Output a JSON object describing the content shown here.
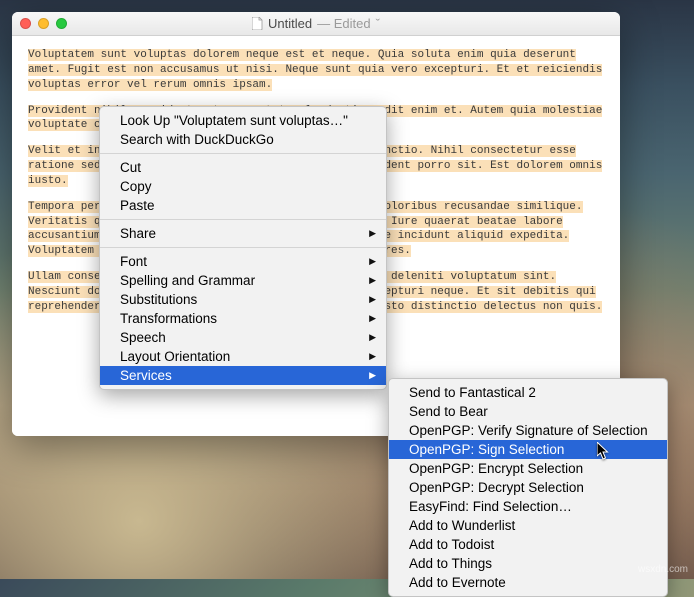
{
  "window": {
    "title": "Untitled",
    "subtitle": "— Edited",
    "status_suffix": "ˇ"
  },
  "editor": {
    "paragraphs": [
      "Voluptatem sunt voluptas dolorem neque est et neque. Quia soluta enim quia deserunt amet. Fugit est non accusamus ut nisi. Neque sunt quia vero excepturi. Et et reiciendis voluptas error vel rerum omnis ipsam.",
      "Provident nihil provident aut consectetur laudantium odit enim et. Autem quia molestiae voluptate consequuntur ut deleniti eat.",
      "Velit et in voluptas sit perspiciatis quas error distinctio. Nihil consectetur esse ratione sed aliquid quidem voluptates a. Tempora provident porro sit. Est dolorem omnis iusto.",
      "Tempora perferendis nesciunt. Alias rerum eos facere doloribus recusandae similique. Veritatis qui voluptatem. Sed dolores culpa molestias. Iure quaerat beatae labore accusantium aut totam. Omnis natus ipsum eaque rem iure incidunt aliquid expedita. Voluptatem eius consequatur sit aut laboriosam asperiores.",
      "Ullam consequatur ut ab sunt eos. Illum vel modi animi deleniti voluptatum sint. Nesciunt dolor eos id ut voluptas. Nam dignissimos excepturi neque. Et sit debitis qui reprehenderit laudantium molestias. Voluptas soluta iusto distinctio delectus non quis."
    ]
  },
  "context_menu": {
    "lookup": "Look Up \"Voluptatem sunt voluptas…\"",
    "search": "Search with DuckDuckGo",
    "cut": "Cut",
    "copy": "Copy",
    "paste": "Paste",
    "share": "Share",
    "font": "Font",
    "spelling": "Spelling and Grammar",
    "substitutions": "Substitutions",
    "transformations": "Transformations",
    "speech": "Speech",
    "layout": "Layout Orientation",
    "services": "Services"
  },
  "services_submenu": {
    "items": [
      "Send to Fantastical 2",
      "Send to Bear",
      "OpenPGP: Verify Signature of Selection",
      "OpenPGP: Sign Selection",
      "OpenPGP: Encrypt Selection",
      "OpenPGP: Decrypt Selection",
      "EasyFind: Find Selection…",
      "Add to Wunderlist",
      "Add to Todoist",
      "Add to Things",
      "Add to Evernote"
    ],
    "highlighted_index": 3
  },
  "watermark": "wsxdn.com"
}
